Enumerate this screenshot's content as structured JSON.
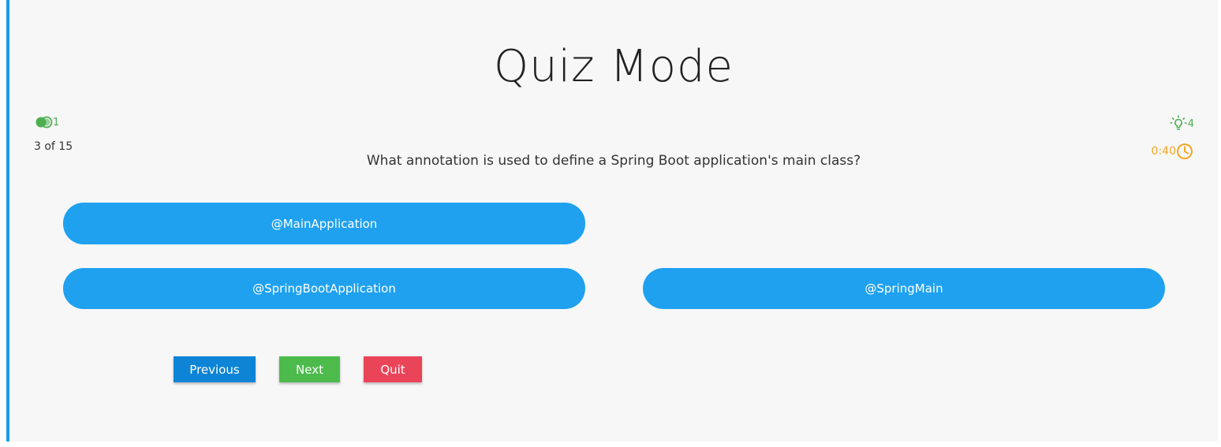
{
  "title": "Quiz Mode",
  "status": {
    "lifelines_count": "1",
    "question_counter": "3 of 15",
    "hints_count": "4",
    "timer": "0:40"
  },
  "question": "What annotation is used to define a Spring Boot application's main class?",
  "options": [
    "@MainApplication",
    "@SpringBootApplication",
    "@SpringMain"
  ],
  "buttons": {
    "previous": "Previous",
    "next": "Next",
    "quit": "Quit"
  },
  "colors": {
    "accent_bar": "#1a9ee6",
    "option_bg": "#1fa1f0",
    "previous_bg": "#0d84d6",
    "next_bg": "#4cbb4c",
    "quit_bg": "#ea4459",
    "lifeline_green": "#4caf50",
    "timer_orange": "#f5a623"
  },
  "icons": {
    "lifelines": "fifty-fifty-icon",
    "hints": "lightbulb-icon",
    "timer": "clock-icon"
  }
}
